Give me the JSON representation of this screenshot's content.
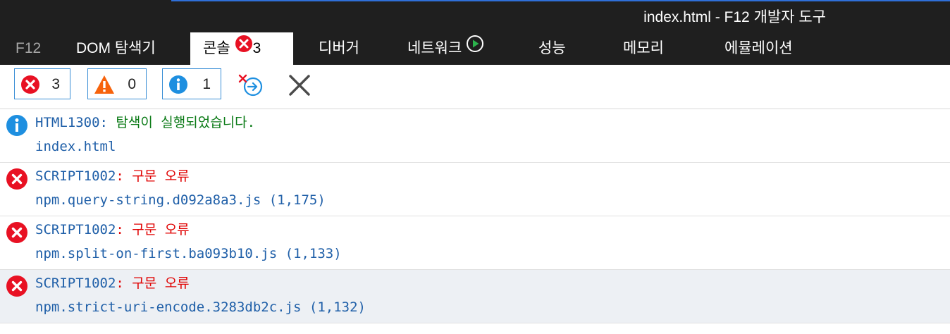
{
  "window": {
    "title": "index.html - F12 개발자 도구"
  },
  "tabs": [
    {
      "label": "F12"
    },
    {
      "label": "DOM 탐색기"
    },
    {
      "label": "콘솔",
      "badge_count": "3"
    },
    {
      "label": "디버거"
    },
    {
      "label": "네트워크"
    },
    {
      "label": "성능"
    },
    {
      "label": "메모리"
    },
    {
      "label": "에뮬레이션"
    }
  ],
  "toolbar": {
    "errors_count": "3",
    "warnings_count": "0",
    "info_count": "1"
  },
  "console": [
    {
      "type": "info",
      "code": "HTML1300",
      "sep": ":",
      "message": "탐색이 실행되었습니다.",
      "source": "index.html"
    },
    {
      "type": "error",
      "code": "SCRIPT1002",
      "sep": ":",
      "message": "구문 오류",
      "source": "npm.query-string.d092a8a3.js (1,175)"
    },
    {
      "type": "error",
      "code": "SCRIPT1002",
      "sep": ":",
      "message": "구문 오류",
      "source": "npm.split-on-first.ba093b10.js (1,133)"
    },
    {
      "type": "error",
      "code": "SCRIPT1002",
      "sep": ":",
      "message": "구문 오류",
      "source": "npm.strict-uri-encode.3283db2c.js (1,132)"
    }
  ],
  "colors": {
    "error": "#e81123",
    "warning": "#f7630c",
    "info": "#1e8fe0",
    "run": "#2bb24c"
  }
}
